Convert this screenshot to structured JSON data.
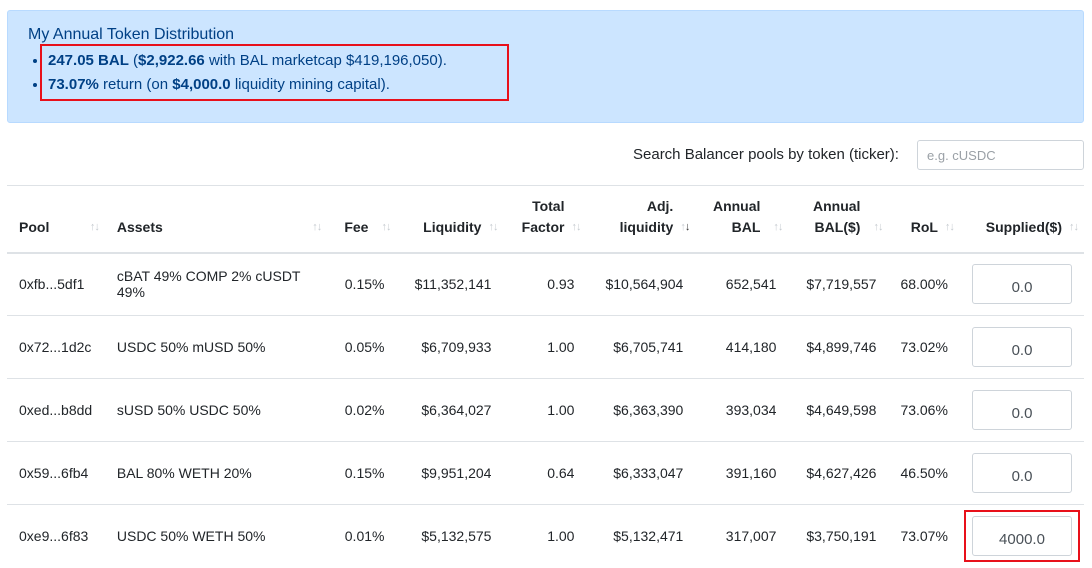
{
  "summary": {
    "title": "My Annual Token Distribution",
    "bal_amount": "247.05 BAL",
    "bal_value": "$2,922.66",
    "bal_mid": "with BAL marketcap $419,196,050",
    "return_pct": "73.07%",
    "return_mid": "return (on",
    "capital": "$4,000.0",
    "capital_suffix": "liquidity mining capital)."
  },
  "search": {
    "label": "Search Balancer pools by token (ticker):",
    "placeholder": "e.g. cUSDC"
  },
  "columns": [
    {
      "line1": "",
      "line2": "Pool"
    },
    {
      "line1": "",
      "line2": "Assets"
    },
    {
      "line1": "",
      "line2": "Fee"
    },
    {
      "line1": "",
      "line2": "Liquidity"
    },
    {
      "line1": "Total",
      "line2": "Factor"
    },
    {
      "line1": "Adj.",
      "line2": "liquidity"
    },
    {
      "line1": "Annual",
      "line2": "BAL"
    },
    {
      "line1": "Annual",
      "line2": "BAL($)"
    },
    {
      "line1": "",
      "line2": "RoL"
    },
    {
      "line1": "",
      "line2": "Supplied($)"
    }
  ],
  "rows": [
    {
      "pool": "0xfb...5df1",
      "assets": "cBAT 49% COMP 2% cUSDT 49%",
      "fee": "0.15%",
      "liquidity": "$11,352,141",
      "factor": "0.93",
      "adj": "$10,564,904",
      "bal": "652,541",
      "bal_usd": "$7,719,557",
      "rol": "68.00%",
      "supplied": "0.0"
    },
    {
      "pool": "0x72...1d2c",
      "assets": "USDC 50% mUSD 50%",
      "fee": "0.05%",
      "liquidity": "$6,709,933",
      "factor": "1.00",
      "adj": "$6,705,741",
      "bal": "414,180",
      "bal_usd": "$4,899,746",
      "rol": "73.02%",
      "supplied": "0.0"
    },
    {
      "pool": "0xed...b8dd",
      "assets": "sUSD 50% USDC 50%",
      "fee": "0.02%",
      "liquidity": "$6,364,027",
      "factor": "1.00",
      "adj": "$6,363,390",
      "bal": "393,034",
      "bal_usd": "$4,649,598",
      "rol": "73.06%",
      "supplied": "0.0"
    },
    {
      "pool": "0x59...6fb4",
      "assets": "BAL 80% WETH 20%",
      "fee": "0.15%",
      "liquidity": "$9,951,204",
      "factor": "0.64",
      "adj": "$6,333,047",
      "bal": "391,160",
      "bal_usd": "$4,627,426",
      "rol": "46.50%",
      "supplied": "0.0"
    },
    {
      "pool": "0xe9...6f83",
      "assets": "USDC 50% WETH 50%",
      "fee": "0.01%",
      "liquidity": "$5,132,575",
      "factor": "1.00",
      "adj": "$5,132,471",
      "bal": "317,007",
      "bal_usd": "$3,750,191",
      "rol": "73.07%",
      "supplied": "4000.0"
    }
  ],
  "colors": {
    "alert_bg": "#cce5ff",
    "alert_text": "#004085",
    "highlight": "#e8101a"
  }
}
